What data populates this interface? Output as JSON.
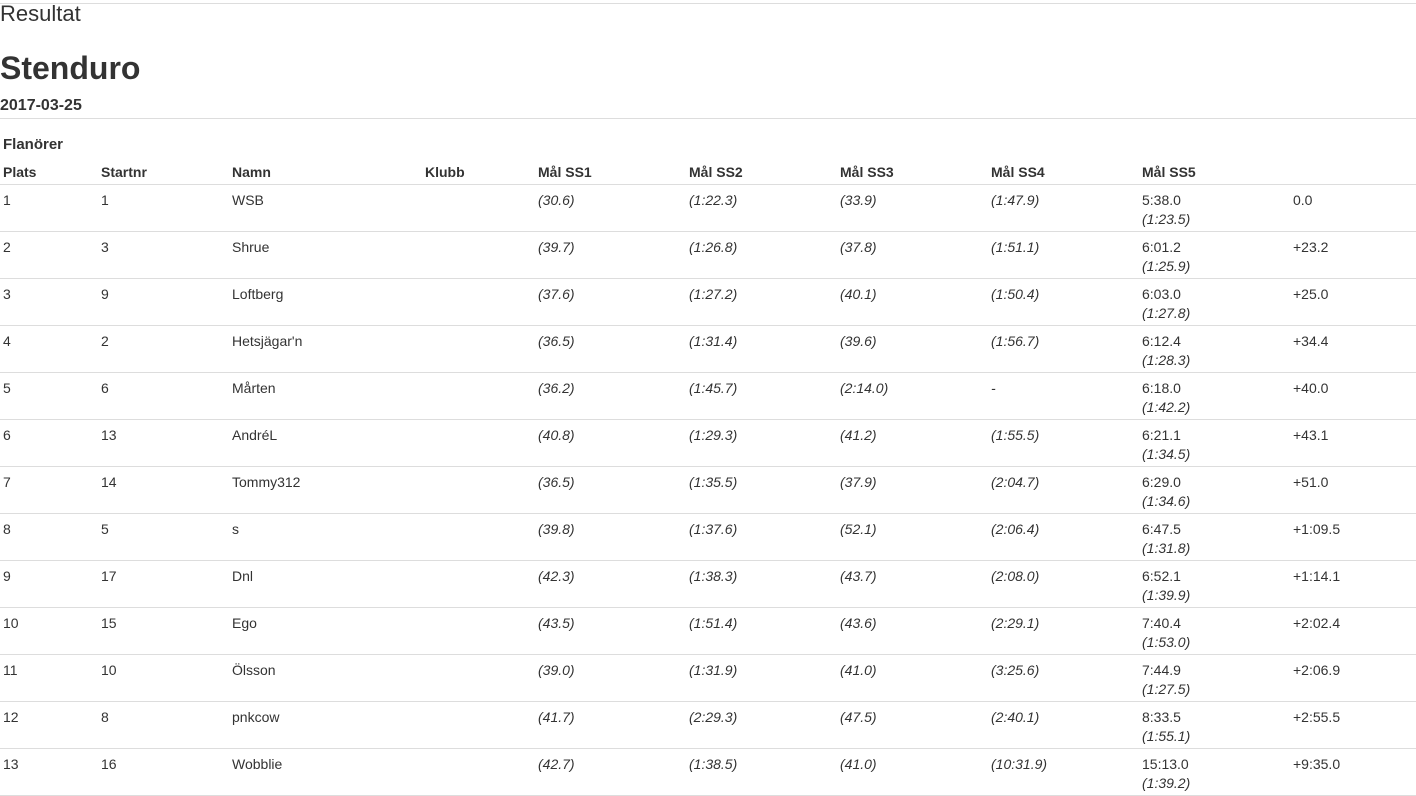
{
  "page": {
    "kicker": "Resultat",
    "title": "Stenduro",
    "date": "2017-03-25"
  },
  "class": {
    "name": "Flanörer"
  },
  "table": {
    "headers": [
      "Plats",
      "Startnr",
      "Namn",
      "Klubb",
      "Mål SS1",
      "Mål SS2",
      "Mål SS3",
      "Mål SS4",
      "Mål SS5",
      ""
    ],
    "rows": [
      {
        "place": "1",
        "start": "1",
        "name": "WSB",
        "club": "",
        "ss1": "(30.6)",
        "ss2": "(1:22.3)",
        "ss3": "(33.9)",
        "ss4": "(1:47.9)",
        "total": "5:38.0",
        "ss5": "(1:23.5)",
        "diff": "0.0"
      },
      {
        "place": "2",
        "start": "3",
        "name": "Shrue",
        "club": "",
        "ss1": "(39.7)",
        "ss2": "(1:26.8)",
        "ss3": "(37.8)",
        "ss4": "(1:51.1)",
        "total": "6:01.2",
        "ss5": "(1:25.9)",
        "diff": "+23.2"
      },
      {
        "place": "3",
        "start": "9",
        "name": "Loftberg",
        "club": "",
        "ss1": "(37.6)",
        "ss2": "(1:27.2)",
        "ss3": "(40.1)",
        "ss4": "(1:50.4)",
        "total": "6:03.0",
        "ss5": "(1:27.8)",
        "diff": "+25.0"
      },
      {
        "place": "4",
        "start": "2",
        "name": "Hetsjägar'n",
        "club": "",
        "ss1": "(36.5)",
        "ss2": "(1:31.4)",
        "ss3": "(39.6)",
        "ss4": "(1:56.7)",
        "total": "6:12.4",
        "ss5": "(1:28.3)",
        "diff": "+34.4"
      },
      {
        "place": "5",
        "start": "6",
        "name": "Mårten",
        "club": "",
        "ss1": "(36.2)",
        "ss2": "(1:45.7)",
        "ss3": "(2:14.0)",
        "ss4": "-",
        "total": "6:18.0",
        "ss5": "(1:42.2)",
        "diff": "+40.0"
      },
      {
        "place": "6",
        "start": "13",
        "name": "AndréL",
        "club": "",
        "ss1": "(40.8)",
        "ss2": "(1:29.3)",
        "ss3": "(41.2)",
        "ss4": "(1:55.5)",
        "total": "6:21.1",
        "ss5": "(1:34.5)",
        "diff": "+43.1"
      },
      {
        "place": "7",
        "start": "14",
        "name": "Tommy312",
        "club": "",
        "ss1": "(36.5)",
        "ss2": "(1:35.5)",
        "ss3": "(37.9)",
        "ss4": "(2:04.7)",
        "total": "6:29.0",
        "ss5": "(1:34.6)",
        "diff": "+51.0"
      },
      {
        "place": "8",
        "start": "5",
        "name": "s",
        "club": "",
        "ss1": "(39.8)",
        "ss2": "(1:37.6)",
        "ss3": "(52.1)",
        "ss4": "(2:06.4)",
        "total": "6:47.5",
        "ss5": "(1:31.8)",
        "diff": "+1:09.5"
      },
      {
        "place": "9",
        "start": "17",
        "name": "Dnl",
        "club": "",
        "ss1": "(42.3)",
        "ss2": "(1:38.3)",
        "ss3": "(43.7)",
        "ss4": "(2:08.0)",
        "total": "6:52.1",
        "ss5": "(1:39.9)",
        "diff": "+1:14.1"
      },
      {
        "place": "10",
        "start": "15",
        "name": "Ego",
        "club": "",
        "ss1": "(43.5)",
        "ss2": "(1:51.4)",
        "ss3": "(43.6)",
        "ss4": "(2:29.1)",
        "total": "7:40.4",
        "ss5": "(1:53.0)",
        "diff": "+2:02.4"
      },
      {
        "place": "11",
        "start": "10",
        "name": "Ölsson",
        "club": "",
        "ss1": "(39.0)",
        "ss2": "(1:31.9)",
        "ss3": "(41.0)",
        "ss4": "(3:25.6)",
        "total": "7:44.9",
        "ss5": "(1:27.5)",
        "diff": "+2:06.9"
      },
      {
        "place": "12",
        "start": "8",
        "name": "pnkcow",
        "club": "",
        "ss1": "(41.7)",
        "ss2": "(2:29.3)",
        "ss3": "(47.5)",
        "ss4": "(2:40.1)",
        "total": "8:33.5",
        "ss5": "(1:55.1)",
        "diff": "+2:55.5"
      },
      {
        "place": "13",
        "start": "16",
        "name": "Wobblie",
        "club": "",
        "ss1": "(42.7)",
        "ss2": "(1:38.5)",
        "ss3": "(41.0)",
        "ss4": "(10:31.9)",
        "total": "15:13.0",
        "ss5": "(1:39.2)",
        "diff": "+9:35.0"
      }
    ]
  }
}
